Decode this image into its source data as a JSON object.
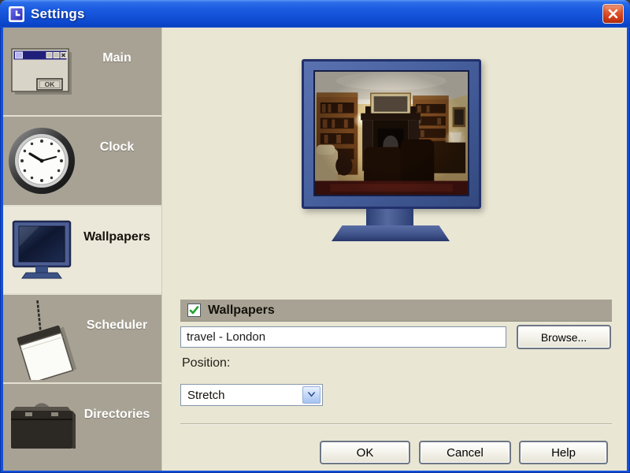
{
  "window": {
    "title": "Settings"
  },
  "sidebar": {
    "items": [
      {
        "label": "Main",
        "icon": "mini-window-icon",
        "selected": false,
        "icon_button_text": "OK"
      },
      {
        "label": "Clock",
        "icon": "clock-icon",
        "selected": false
      },
      {
        "label": "Wallpapers",
        "icon": "monitor-icon",
        "selected": true
      },
      {
        "label": "Scheduler",
        "icon": "notepad-icon",
        "selected": false
      },
      {
        "label": "Directories",
        "icon": "briefcase-icon",
        "selected": false
      }
    ]
  },
  "preview": {
    "image": "living-room-with-fireplace-wallpaper"
  },
  "wallpapers_section": {
    "header_label": "Wallpapers",
    "checkbox_checked": true,
    "filename_value": "travel - London",
    "browse_label": "Browse...",
    "position_label": "Position:",
    "position_value": "Stretch"
  },
  "footer": {
    "ok": "OK",
    "cancel": "Cancel",
    "help": "Help"
  },
  "colors": {
    "titlebar_blue": "#1a5ae0",
    "sidebar_gray": "#a7a294",
    "panel_cream": "#e9e6d3",
    "selected_cream": "#ebe8d9",
    "check_green": "#1ca32a",
    "close_red": "#cf3b15",
    "monitor_blue": "#47609e"
  }
}
